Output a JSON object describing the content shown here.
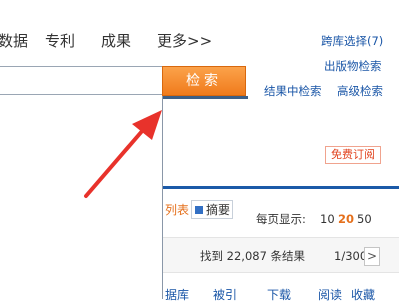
{
  "nav": {
    "items": [
      "数据",
      "专利",
      "成果",
      "更多>>"
    ]
  },
  "links": {
    "cross_db": "跨库选择(7)",
    "publication": "出版物检索",
    "in_results": "结果中检索",
    "advanced": "高级检索"
  },
  "search": {
    "value": "",
    "button_label": "检索"
  },
  "subscribe_label": "免费订阅",
  "view_tabs": {
    "list": "列表",
    "abstract": "摘要"
  },
  "per_page": {
    "label": "每页显示:",
    "options": [
      "10",
      "20",
      "50"
    ],
    "selected": "20"
  },
  "results": {
    "count_text": "找到 22,087 条结果",
    "page_text": "1/300",
    "next_label": ">"
  },
  "columns": [
    "据库",
    "被引",
    "下载",
    "阅读",
    "收藏"
  ],
  "colors": {
    "accent_orange": "#f07b1c",
    "link_blue": "#1a56a7",
    "arrow_red": "#e8322b",
    "bar_blue": "#1b5aa8"
  }
}
